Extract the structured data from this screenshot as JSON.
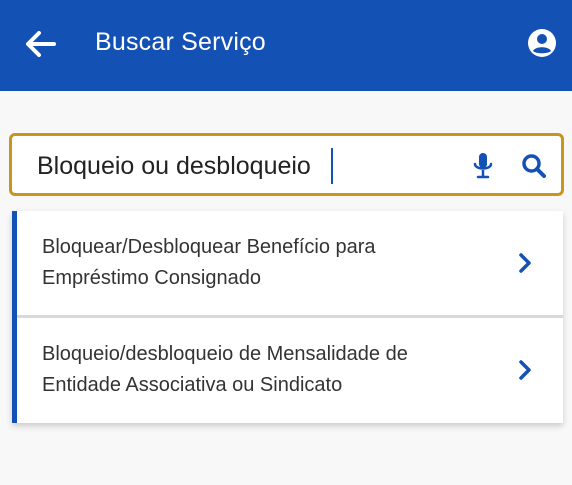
{
  "header": {
    "title": "Buscar Serviço",
    "back_icon": "arrow-left-icon",
    "profile_icon": "account-circle-icon",
    "background_color": "#1351b4"
  },
  "search": {
    "value": "Bloqueio ou desbloqueio",
    "mic_icon": "microphone-icon",
    "search_icon": "search-icon",
    "border_color": "#c8961d"
  },
  "results": {
    "accent_color": "#1351b4",
    "items": [
      {
        "line1": "Bloquear/Desbloquear Benefício para",
        "line2": "Empréstimo Consignado"
      },
      {
        "line1": "Bloqueio/desbloqueio de Mensalidade de",
        "line2": "Entidade Associativa ou Sindicato"
      }
    ]
  }
}
